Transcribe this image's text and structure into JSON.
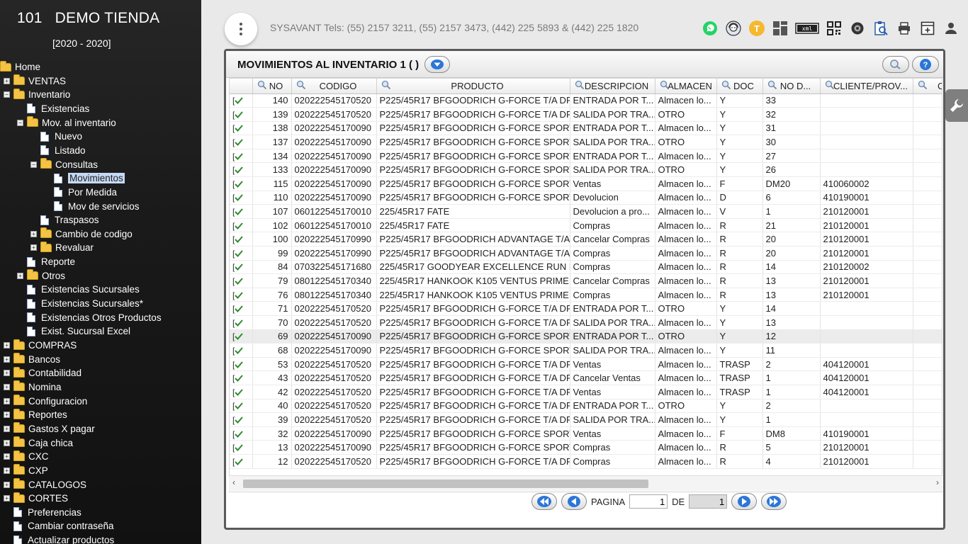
{
  "sidebar": {
    "store_code": "101",
    "store_name": "DEMO TIENDA",
    "period": "[2020 - 2020]",
    "tree": [
      {
        "label": "Home",
        "kind": "folder-open",
        "level": 0,
        "toggle": ""
      },
      {
        "label": "VENTAS",
        "kind": "folder",
        "level": 1,
        "toggle": "+"
      },
      {
        "label": "Inventario",
        "kind": "folder-open",
        "level": 1,
        "toggle": "-"
      },
      {
        "label": "Existencias",
        "kind": "doc",
        "level": 2,
        "toggle": ""
      },
      {
        "label": "Mov. al inventario",
        "kind": "folder-open",
        "level": 2,
        "toggle": "-"
      },
      {
        "label": "Nuevo",
        "kind": "doc",
        "level": 3,
        "toggle": ""
      },
      {
        "label": "Listado",
        "kind": "doc",
        "level": 3,
        "toggle": ""
      },
      {
        "label": "Consultas",
        "kind": "folder-open",
        "level": 3,
        "toggle": "-"
      },
      {
        "label": "Movimientos",
        "kind": "doc",
        "level": 4,
        "toggle": "",
        "selected": true
      },
      {
        "label": "Por Medida",
        "kind": "doc",
        "level": 4,
        "toggle": ""
      },
      {
        "label": "Mov de servicios",
        "kind": "doc",
        "level": 4,
        "toggle": ""
      },
      {
        "label": "Traspasos",
        "kind": "doc",
        "level": 3,
        "toggle": ""
      },
      {
        "label": "Cambio de codigo",
        "kind": "folder",
        "level": 3,
        "toggle": "+"
      },
      {
        "label": "Revaluar",
        "kind": "folder",
        "level": 3,
        "toggle": "+"
      },
      {
        "label": "Reporte",
        "kind": "doc",
        "level": 2,
        "toggle": ""
      },
      {
        "label": "Otros",
        "kind": "folder",
        "level": 2,
        "toggle": "+"
      },
      {
        "label": "Existencias Sucursales",
        "kind": "doc",
        "level": 2,
        "toggle": ""
      },
      {
        "label": "Existencias Sucursales*",
        "kind": "doc",
        "level": 2,
        "toggle": ""
      },
      {
        "label": "Existencias Otros Productos",
        "kind": "doc",
        "level": 2,
        "toggle": ""
      },
      {
        "label": "Exist. Sucursal Excel",
        "kind": "doc",
        "level": 2,
        "toggle": ""
      },
      {
        "label": "COMPRAS",
        "kind": "folder",
        "level": 1,
        "toggle": "+"
      },
      {
        "label": "Bancos",
        "kind": "folder",
        "level": 1,
        "toggle": "+"
      },
      {
        "label": "Contabilidad",
        "kind": "folder",
        "level": 1,
        "toggle": "+"
      },
      {
        "label": "Nomina",
        "kind": "folder",
        "level": 1,
        "toggle": "+"
      },
      {
        "label": "Configuracion",
        "kind": "folder",
        "level": 1,
        "toggle": "+"
      },
      {
        "label": "Reportes",
        "kind": "folder",
        "level": 1,
        "toggle": "+"
      },
      {
        "label": "Gastos X pagar",
        "kind": "folder",
        "level": 1,
        "toggle": "+"
      },
      {
        "label": "Caja chica",
        "kind": "folder",
        "level": 1,
        "toggle": "+"
      },
      {
        "label": "CXC",
        "kind": "folder",
        "level": 1,
        "toggle": "+"
      },
      {
        "label": "CXP",
        "kind": "folder",
        "level": 1,
        "toggle": "+"
      },
      {
        "label": "CATALOGOS",
        "kind": "folder",
        "level": 1,
        "toggle": "+"
      },
      {
        "label": "CORTES",
        "kind": "folder",
        "level": 1,
        "toggle": "+"
      },
      {
        "label": "Preferencias",
        "kind": "doc",
        "level": 1,
        "toggle": ""
      },
      {
        "label": "Cambiar contraseña",
        "kind": "doc",
        "level": 1,
        "toggle": ""
      },
      {
        "label": "Actualizar productos",
        "kind": "doc",
        "level": 1,
        "toggle": ""
      }
    ]
  },
  "header": {
    "company_info": "SYSAVANT Tels: (55) 2157 3211, (55) 2157 3473, (442) 225 5893 & (442) 225 1820",
    "toolbar_icons": [
      "whatsapp-icon",
      "support-agent-icon",
      "tokens-icon",
      "dashboard-icon",
      "xml-icon",
      "qr-code-icon",
      "tire-icon",
      "clipboard-search-icon",
      "printer-icon",
      "add-window-icon",
      "user-icon"
    ],
    "token_letter": "T",
    "xml_label": "xml"
  },
  "panel": {
    "title": "MOVIMIENTOS AL INVENTARIO 1 ( )",
    "columns": [
      "",
      "NO",
      "CODIGO",
      "PRODUCTO",
      "DESCRIPCION",
      "ALMACEN",
      "DOC",
      "NO D...",
      "CLIENTE/PROV...",
      "CA"
    ],
    "rows": [
      [
        "140",
        "020222545170520",
        "P225/45R17 BFGOODRICH G-FORCE T/A DR...",
        "ENTRADA POR T...",
        "Almacen lo...",
        "Y",
        "33",
        ""
      ],
      [
        "139",
        "020222545170520",
        "P225/45R17 BFGOODRICH G-FORCE T/A DR...",
        "SALIDA POR TRA...",
        "OTRO",
        "Y",
        "32",
        ""
      ],
      [
        "138",
        "020222545170090",
        "P225/45R17 BFGOODRICH G-FORCE SPORT...",
        "ENTRADA POR T...",
        "Almacen lo...",
        "Y",
        "31",
        ""
      ],
      [
        "137",
        "020222545170090",
        "P225/45R17 BFGOODRICH G-FORCE SPORT...",
        "SALIDA POR TRA...",
        "OTRO",
        "Y",
        "30",
        ""
      ],
      [
        "134",
        "020222545170090",
        "P225/45R17 BFGOODRICH G-FORCE SPORT...",
        "ENTRADA POR T...",
        "Almacen lo...",
        "Y",
        "27",
        ""
      ],
      [
        "133",
        "020222545170090",
        "P225/45R17 BFGOODRICH G-FORCE SPORT...",
        "SALIDA POR TRA...",
        "OTRO",
        "Y",
        "26",
        ""
      ],
      [
        "115",
        "020222545170090",
        "P225/45R17 BFGOODRICH G-FORCE SPORT...",
        "Ventas",
        "Almacen lo...",
        "F",
        "DM20",
        "410060002"
      ],
      [
        "110",
        "020222545170090",
        "P225/45R17 BFGOODRICH G-FORCE SPORT...",
        "Devolucion",
        "Almacen lo...",
        "D",
        "6",
        "410190001"
      ],
      [
        "107",
        "060122545170010",
        "225/45R17 FATE",
        "Devolucion a pro...",
        "Almacen lo...",
        "V",
        "1",
        "210120001"
      ],
      [
        "102",
        "060122545170010",
        "225/45R17 FATE",
        "Compras",
        "Almacen lo...",
        "R",
        "21",
        "210120001"
      ],
      [
        "100",
        "020222545170990",
        "P225/45R17 BFGOODRICH ADVANTAGE T/A...",
        "Cancelar Compras",
        "Almacen lo...",
        "R",
        "20",
        "210120001"
      ],
      [
        "99",
        "020222545170990",
        "P225/45R17 BFGOODRICH ADVANTAGE T/A...",
        "Compras",
        "Almacen lo...",
        "R",
        "20",
        "210120001"
      ],
      [
        "84",
        "070322545171680",
        "225/45R17 GOODYEAR EXCELLENCE RUN F...",
        "Compras",
        "Almacen lo...",
        "R",
        "14",
        "210120002"
      ],
      [
        "79",
        "080122545170340",
        "225/45R17 HANKOOK K105 VENTUS PRIME",
        "Cancelar Compras",
        "Almacen lo...",
        "R",
        "13",
        "210120001"
      ],
      [
        "76",
        "080122545170340",
        "225/45R17 HANKOOK K105 VENTUS PRIME",
        "Compras",
        "Almacen lo...",
        "R",
        "13",
        "210120001"
      ],
      [
        "71",
        "020222545170520",
        "P225/45R17 BFGOODRICH G-FORCE T/A DR...",
        "ENTRADA POR T...",
        "OTRO",
        "Y",
        "14",
        ""
      ],
      [
        "70",
        "020222545170520",
        "P225/45R17 BFGOODRICH G-FORCE T/A DR...",
        "SALIDA POR TRA...",
        "Almacen lo...",
        "Y",
        "13",
        ""
      ],
      [
        "69",
        "020222545170090",
        "P225/45R17 BFGOODRICH G-FORCE SPORT...",
        "ENTRADA POR T...",
        "OTRO",
        "Y",
        "12",
        ""
      ],
      [
        "68",
        "020222545170090",
        "P225/45R17 BFGOODRICH G-FORCE SPORT...",
        "SALIDA POR TRA...",
        "Almacen lo...",
        "Y",
        "11",
        ""
      ],
      [
        "53",
        "020222545170520",
        "P225/45R17 BFGOODRICH G-FORCE T/A DR...",
        "Ventas",
        "Almacen lo...",
        "TRASP",
        "2",
        "404120001"
      ],
      [
        "43",
        "020222545170520",
        "P225/45R17 BFGOODRICH G-FORCE T/A DR...",
        "Cancelar Ventas",
        "Almacen lo...",
        "TRASP",
        "1",
        "404120001"
      ],
      [
        "42",
        "020222545170520",
        "P225/45R17 BFGOODRICH G-FORCE T/A DR...",
        "Ventas",
        "Almacen lo...",
        "TRASP",
        "1",
        "404120001"
      ],
      [
        "40",
        "020222545170520",
        "P225/45R17 BFGOODRICH G-FORCE T/A DR...",
        "ENTRADA POR T...",
        "OTRO",
        "Y",
        "2",
        ""
      ],
      [
        "39",
        "020222545170520",
        "P225/45R17 BFGOODRICH G-FORCE T/A DR...",
        "SALIDA POR TRA...",
        "Almacen lo...",
        "Y",
        "1",
        ""
      ],
      [
        "32",
        "020222545170090",
        "P225/45R17 BFGOODRICH G-FORCE SPORT...",
        "Ventas",
        "Almacen lo...",
        "F",
        "DM8",
        "410190001"
      ],
      [
        "13",
        "020222545170090",
        "P225/45R17 BFGOODRICH G-FORCE SPORT...",
        "Compras",
        "Almacen lo...",
        "R",
        "5",
        "210120001"
      ],
      [
        "12",
        "020222545170520",
        "P225/45R17 BFGOODRICH G-FORCE T/A DR...",
        "Compras",
        "Almacen lo...",
        "R",
        "4",
        "210120001"
      ]
    ],
    "highlighted_row": 17
  },
  "pager": {
    "label": "PAGINA",
    "page": "1",
    "of_label": "DE",
    "total": "1"
  },
  "colors": {
    "sidebar_bg": "#1a1a1a",
    "accent_blue": "#1f6fd6",
    "check_green": "#2e8b2e"
  }
}
